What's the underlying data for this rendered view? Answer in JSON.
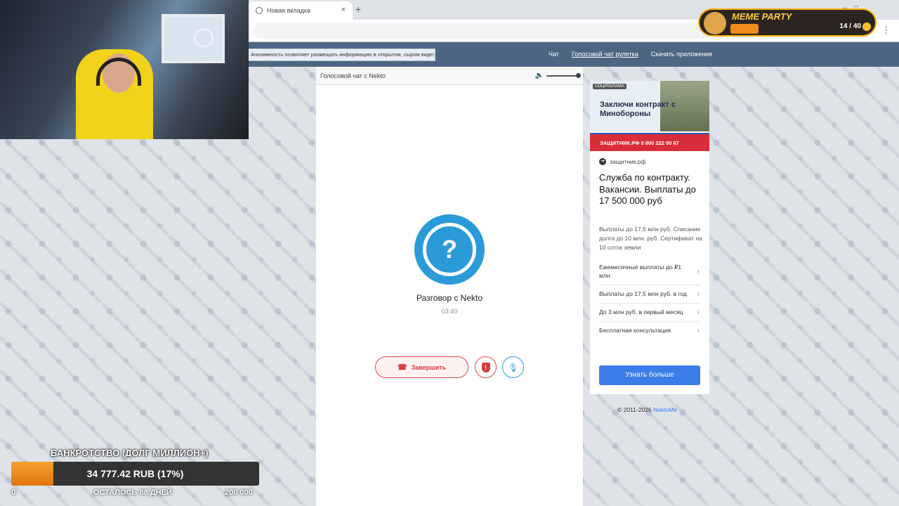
{
  "browser": {
    "tab_title": "Новая вкладка",
    "new_tab": "+",
    "menu": "⋮"
  },
  "site": {
    "notice": "Анонимность позволяет размещать информацию в открытом, сыром виде!",
    "nav": [
      "Чат",
      "Голосовой чат рулетка",
      "Скачать приложения"
    ],
    "active_nav": "Голосовой чат рулетка"
  },
  "voice_chat": {
    "header": "Голосовой чат с Nekto",
    "avatar_symbol": "?",
    "title": "Разговор с Nekto",
    "timer": "03:40",
    "end_label": "Завершить",
    "volume": 1.0,
    "accent": "#2a9ad8",
    "danger": "#d73b3b"
  },
  "ad": {
    "badge": "СОЦРЕКЛАМА",
    "banner_text": "Заключи контракт с Минобороны",
    "banner_strip": "ЗАЩИТНИК.РФ  8 800 222 00 67",
    "domain": "защитник.рф",
    "title": "Служба по контракту. Вакансии. Выплаты до 17 500 000 руб",
    "description": "Выплаты до 17,5 млн руб. Списание долга до 10 млн. руб. Сертификат на 10 соток земли",
    "links": [
      "Ежемесячные выплаты до ₽1 млн.",
      "Выплаты до 17,5 млн руб. в год",
      "До 3 млн руб. в первый месяц",
      "Бесплатная консультация"
    ],
    "button": "Узнать больше"
  },
  "footer": {
    "copyright": "© 2011-2026",
    "link": "NektoMe"
  },
  "overlay": {
    "meme_title": "MEME PARTY",
    "meme_count": "14 / 40",
    "debt_title": "БАНКРОТСТВО (ДОЛГ МИЛЛИОН+)",
    "debt_value": "34 777.42 RUB (17%)",
    "debt_progress": 0.17,
    "debt_min": "0",
    "debt_remaining": "ОСТАЛОСЬ 88 ДНЕЙ",
    "debt_max": "200 000"
  }
}
